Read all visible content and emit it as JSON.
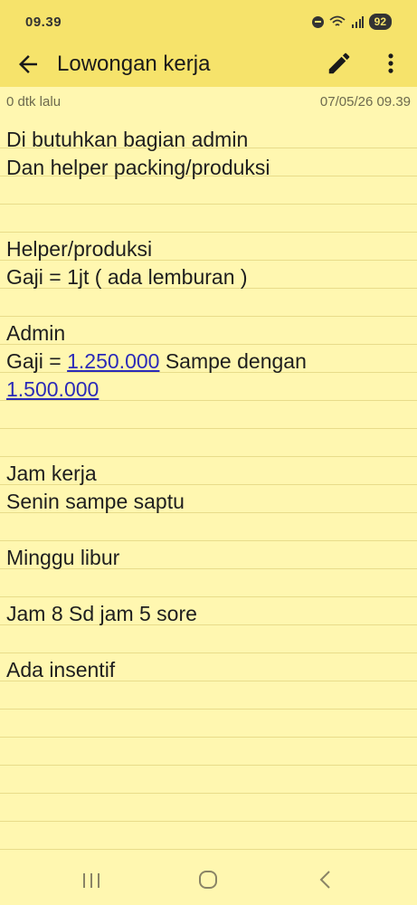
{
  "status_bar": {
    "time": "09.39",
    "battery": "92"
  },
  "app_bar": {
    "title": "Lowongan kerja",
    "icons": [
      "back-arrow-icon",
      "pencil-icon",
      "more-vert-icon"
    ]
  },
  "meta": {
    "edited": "0 dtk lalu",
    "datetime": "07/05/26 09.39"
  },
  "note": {
    "line1": "Di butuhkan bagian admin",
    "line2": "Dan helper packing/produksi",
    "line3": "Helper/produksi",
    "line4": "Gaji = 1jt ( ada lemburan )",
    "line5": "Admin",
    "line6_prefix": "Gaji = ",
    "line6_link": "1.250.000",
    "line6_suffix": " Sampe dengan",
    "line7_link": "1.500.000",
    "line8": "Jam kerja",
    "line9": "Senin sampe saptu",
    "line10": "Minggu libur",
    "line11": "Jam 8 Sd jam 5 sore",
    "line12": "Ada insentif"
  },
  "colors": {
    "header": "#F6E36B",
    "paper": "#FFF7B0",
    "rule": "#E8DC8A",
    "link": "#2b2bb8"
  },
  "nav_bar": {
    "icons": [
      "recent-apps-icon",
      "home-icon",
      "back-icon"
    ]
  }
}
